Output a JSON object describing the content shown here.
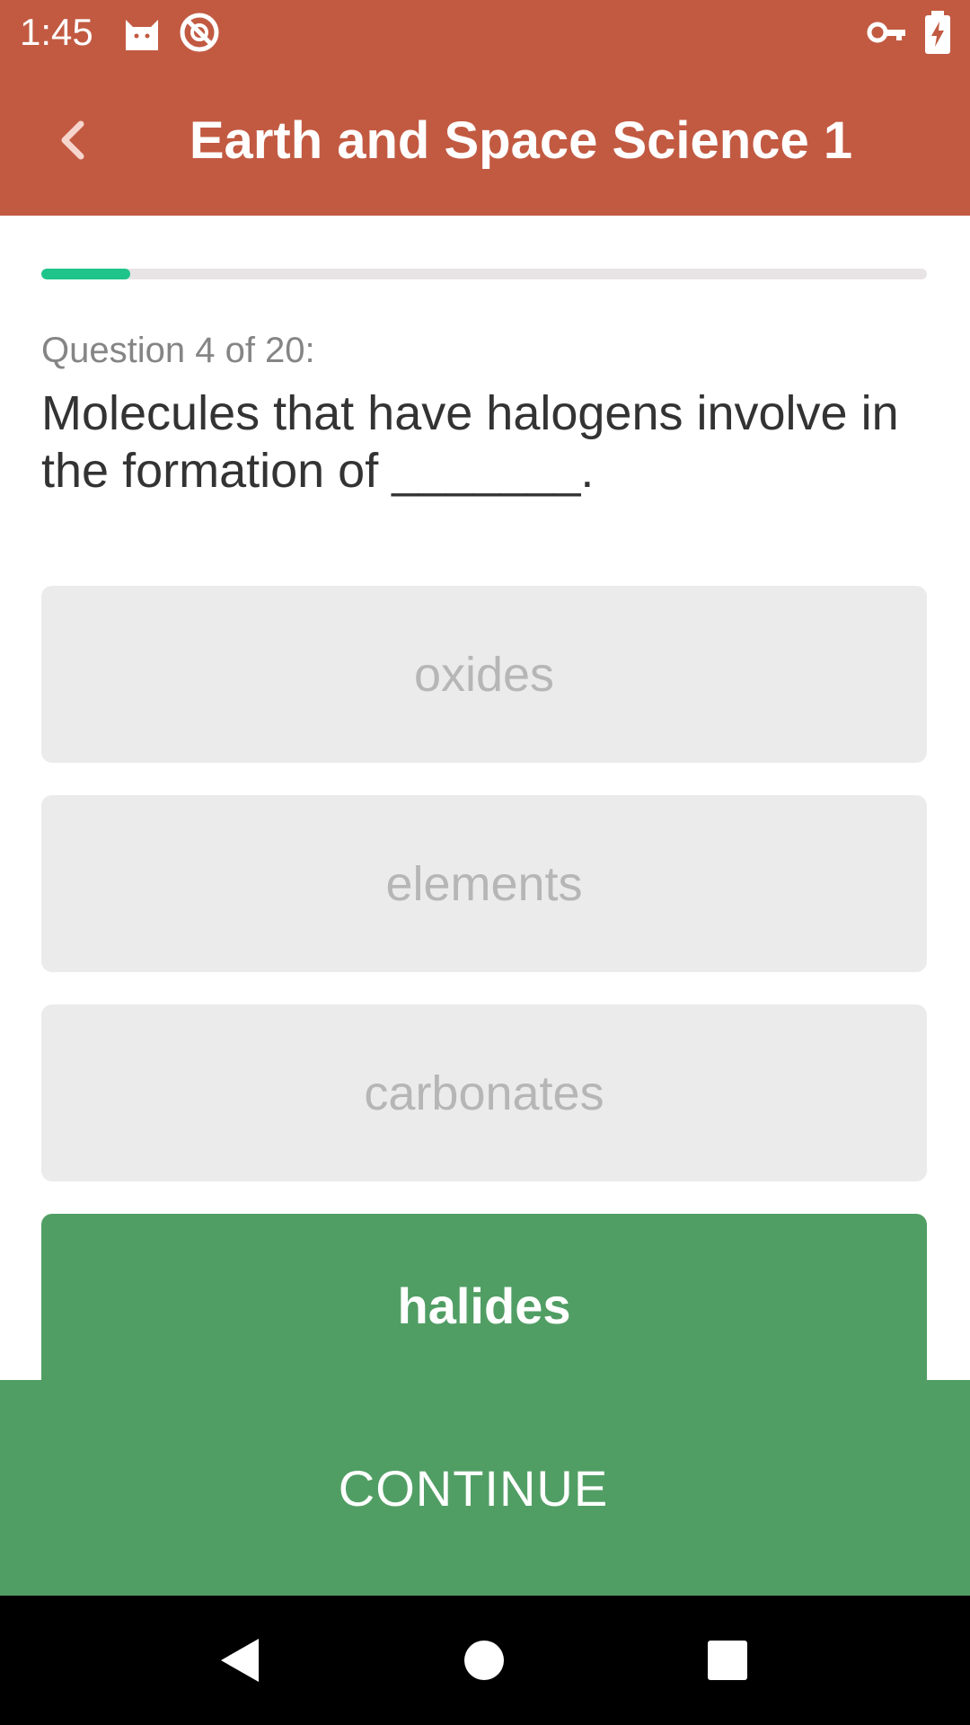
{
  "status_bar": {
    "time": "1:45",
    "icons": [
      "cat-icon",
      "no-disturb-icon",
      "vpn-key-icon",
      "battery-charging-icon"
    ]
  },
  "app_bar": {
    "title": "Earth and Space Science 1",
    "back_icon": "chevron-left-icon"
  },
  "quiz": {
    "progress_fraction": 0.1,
    "question_counter": "Question 4 of 20:",
    "question_text": "Molecules that have halogens involve in the formation of _______.",
    "options": [
      {
        "label": "oxides",
        "state": "unselected"
      },
      {
        "label": "elements",
        "state": "unselected"
      },
      {
        "label": "carbonates",
        "state": "unselected"
      },
      {
        "label": "halides",
        "state": "correct"
      }
    ]
  },
  "footer": {
    "continue_label": "CONTINUE"
  },
  "nav_bar": {
    "icons": [
      "nav-back-icon",
      "nav-home-icon",
      "nav-recents-icon"
    ]
  },
  "colors": {
    "app_bar": "#c25a42",
    "progress": "#1ec48a",
    "correct": "#519e64",
    "option_bg": "#ebebeb",
    "option_text": "#b6b6b6"
  }
}
